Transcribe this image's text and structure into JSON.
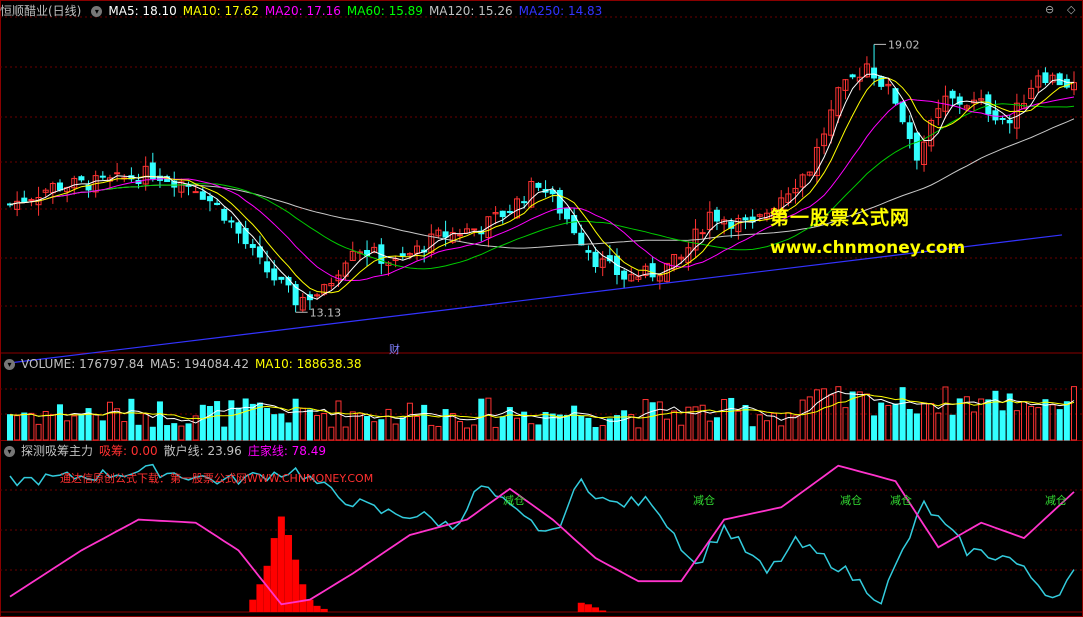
{
  "header_main": {
    "title": "恒顺醋业(日线)",
    "items": [
      {
        "label": "MA5: 18.10",
        "color": "#ffffff"
      },
      {
        "label": "MA10: 17.62",
        "color": "#ffff00"
      },
      {
        "label": "MA20: 17.16",
        "color": "#ff00ff"
      },
      {
        "label": "MA60: 15.89",
        "color": "#00ff00"
      },
      {
        "label": "MA120: 15.26",
        "color": "#c0c0c0"
      },
      {
        "label": "MA250: 14.83",
        "color": "#3333ff"
      }
    ]
  },
  "header_volume": {
    "items": [
      {
        "label": "VOLUME: 176797.84",
        "color": "#c0c0c0"
      },
      {
        "label": "MA5: 194084.42",
        "color": "#c0c0c0"
      },
      {
        "label": "MA10: 188638.38",
        "color": "#ffff00"
      }
    ]
  },
  "header_indicator": {
    "items": [
      {
        "label": "探测吸筹主力",
        "color": "#c0c0c0"
      },
      {
        "label": "吸筹: 0.00",
        "color": "#ff3030"
      },
      {
        "label": "散户线: 23.96",
        "color": "#c0c0c0"
      },
      {
        "label": "庄家线: 78.49",
        "color": "#ff00ff"
      }
    ]
  },
  "watermark": {
    "line1": "第一股票公式网",
    "line2": "www.chnmoney.com"
  },
  "ad_text": "通达信原创公式下载：第一股票公式网WWW.CHNMONEY.COM",
  "cai_label": "财",
  "reduce_label": "减仓",
  "colors": {
    "up": "#ff3333",
    "down": "#33ffff",
    "ma5": "#ffffff",
    "ma10": "#ffff00",
    "ma20": "#ff00ff",
    "ma60": "#00cc00",
    "ma120": "#c8c8c8",
    "ma250": "#3333ff",
    "retail": "#33ccdd",
    "dealer": "#ff33cc",
    "absorb": "#ff0000",
    "grid": "#6a0000"
  },
  "chart_data": [
    {
      "type": "candlestick",
      "title": "恒顺醋业(日线)",
      "ylim": [
        12.3,
        19.6
      ],
      "annotations": [
        {
          "text": "19.02",
          "value": 19.02,
          "kind": "high"
        },
        {
          "text": "13.13",
          "value": 13.13,
          "kind": "low"
        }
      ],
      "ma250_endpoints": [
        12.0,
        14.83
      ],
      "ma120_endpoints": [
        14.7,
        15.26
      ],
      "ma60_endpoints": [
        15.8,
        15.89
      ]
    },
    {
      "type": "bar",
      "title": "VOLUME",
      "ylim": [
        0,
        350000
      ],
      "values_note": "daily volume bars with MA5/MA10"
    },
    {
      "type": "line",
      "title": "探测吸筹主力",
      "ylim": [
        0,
        100
      ],
      "series": [
        {
          "name": "散户线",
          "last": 23.96
        },
        {
          "name": "庄家线",
          "last": 78.49
        },
        {
          "name": "吸筹",
          "last": 0.0
        }
      ]
    }
  ]
}
